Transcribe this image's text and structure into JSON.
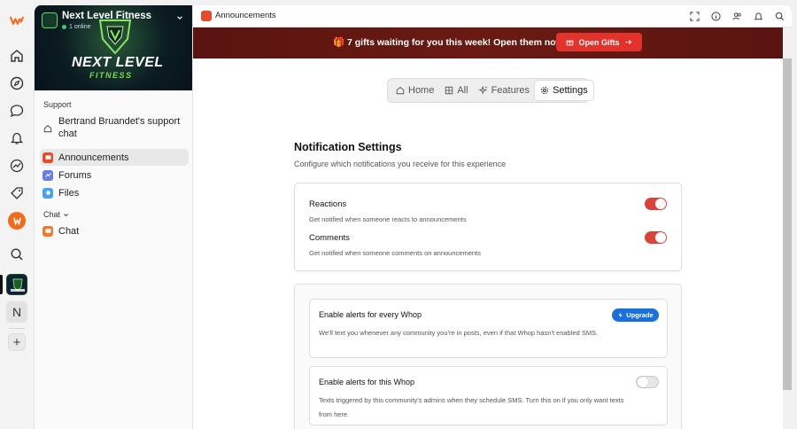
{
  "rail": {
    "items": [
      {
        "name": "whop-logo-icon"
      },
      {
        "name": "home-icon"
      },
      {
        "name": "compass-icon"
      },
      {
        "name": "messages-icon"
      },
      {
        "name": "bell-icon"
      },
      {
        "name": "chart-icon"
      },
      {
        "name": "tag-icon"
      },
      {
        "name": "whop-app-icon"
      },
      {
        "name": "search-icon"
      }
    ],
    "n_label": "N",
    "add_label": "+"
  },
  "sidebar": {
    "community_name": "Next Level Fitness",
    "online": "1 online",
    "banner_line1": "NEXT LEVEL",
    "banner_line2": "FITNESS",
    "support_header": "Support",
    "support_item": "Bertrand Bruandet's support chat",
    "items": [
      {
        "label": "Announcements"
      },
      {
        "label": "Forums"
      },
      {
        "label": "Files"
      }
    ],
    "chat_header": "Chat",
    "chat_item": "Chat"
  },
  "topbar": {
    "title": "Announcements"
  },
  "gift_banner": {
    "text": "🎁 7 gifts waiting for you this week! Open them now.",
    "button": "Open Gifts"
  },
  "tabs": [
    {
      "label": "Home",
      "icon": "home-icon"
    },
    {
      "label": "All",
      "icon": "grid-icon"
    },
    {
      "label": "Features",
      "icon": "sparkle-icon"
    },
    {
      "label": "Settings",
      "icon": "gear-icon"
    }
  ],
  "settings": {
    "title": "Notification Settings",
    "subtitle": "Configure which notifications you receive for this experience",
    "reactions_title": "Reactions",
    "reactions_desc": "Get notified when someone reacts to announcements",
    "reactions_on": true,
    "comments_title": "Comments",
    "comments_desc": "Get notified when someone comments on announcements",
    "comments_on": true,
    "every_title": "Enable alerts for every Whop",
    "every_desc": "We'll text you whenever any community you're in posts, even if that Whop hasn't enabled SMS.",
    "upgrade_label": "Upgrade",
    "this_title": "Enable alerts for this Whop",
    "this_desc": "Texts triggered by this community's admins when they schedule SMS. Turn this on if you only want texts from here.",
    "this_on": false
  },
  "colors": {
    "accent": "#d9443a",
    "gift_button": "#e1322b",
    "upgrade": "#1a6fd8"
  }
}
